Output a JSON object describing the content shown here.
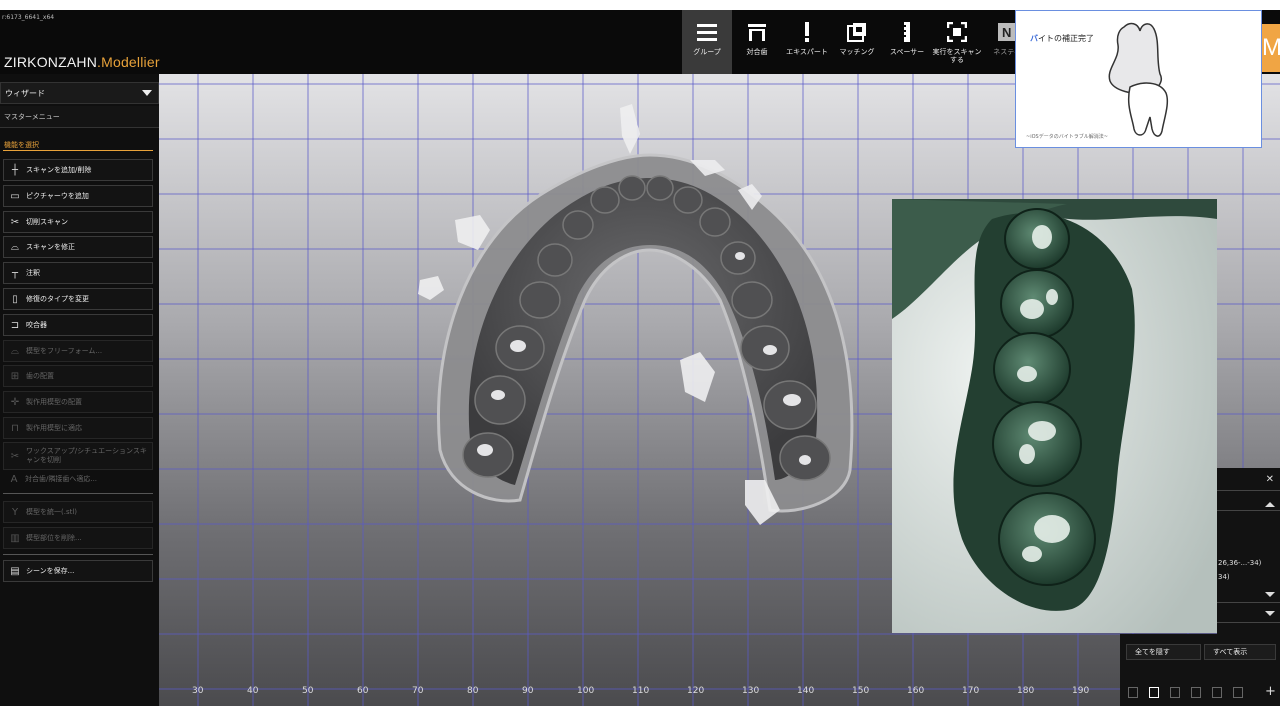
{
  "window": {
    "title": "r:6173_6641_x64"
  },
  "app": {
    "brand": "ZIRKONZAHN",
    "product": ".Modellier"
  },
  "toolbar": {
    "items": [
      {
        "label": "グループ",
        "icon": "menu-icon"
      },
      {
        "label": "対合歯",
        "icon": "antagonist-icon"
      },
      {
        "label": "エキスパート",
        "icon": "exclamation-icon"
      },
      {
        "label": "マッチング",
        "icon": "matching-icon"
      },
      {
        "label": "スペーサー",
        "icon": "spacer-icon"
      },
      {
        "label": "実行をスキャン\nする",
        "icon": "scan-frame-icon"
      },
      {
        "label": "ネスティ",
        "icon": "nesting-icon"
      }
    ],
    "corner_letter": "M"
  },
  "sidebar": {
    "wizard": "ウィザード",
    "master_menu": "マスターメニュー",
    "section_title": "機能を選択",
    "items": [
      {
        "label": "スキャンを追加/削除",
        "icon": "plus-cross-icon"
      },
      {
        "label": "ピクチャーウを追加",
        "icon": "picture-icon"
      },
      {
        "label": "切削スキャン",
        "icon": "scissors-icon"
      },
      {
        "label": "スキャンを修正",
        "icon": "edit-scan-icon"
      },
      {
        "label": "注釈",
        "icon": "pin-icon"
      },
      {
        "label": "修復のタイプを変更",
        "icon": "restoration-icon"
      },
      {
        "label": "咬合器",
        "icon": "articulator-icon"
      },
      {
        "label": "模型をフリーフォーム...",
        "icon": "freeform-icon"
      },
      {
        "label": "歯の配置",
        "icon": "tooth-placement-icon"
      },
      {
        "label": "製作用模型の配置",
        "icon": "model-placement-icon"
      },
      {
        "label": "製作用模型に適応",
        "icon": "model-adapt-icon"
      },
      {
        "label": "ワックスアップ/シチュエーションスキャンを切削",
        "icon": "waxup-cut-icon"
      },
      {
        "label": "対合歯/隣接歯へ適応...",
        "icon": "letter-a-icon"
      },
      {
        "label": "模型を統一(.stl)",
        "icon": "merge-icon"
      },
      {
        "label": "模型部位を削除...",
        "icon": "trash-icon"
      },
      {
        "label": "シーンを保存...",
        "icon": "save-icon"
      }
    ]
  },
  "axis": {
    "ticks": [
      "30",
      "40",
      "50",
      "60",
      "70",
      "80",
      "90",
      "100",
      "110",
      "120",
      "130",
      "140",
      "150",
      "160",
      "170",
      "180",
      "190"
    ]
  },
  "thumbnail": {
    "title_first": "バ",
    "title_rest": "イトの補正完了",
    "footer": "~iOSデータのバイトラブル解消法~"
  },
  "right_panel": {
    "line1": "26,36-...-34)",
    "line2": "34)"
  },
  "bottom_panel": {
    "hide_all": "全てを隠す",
    "show_all": "すべて表示"
  }
}
